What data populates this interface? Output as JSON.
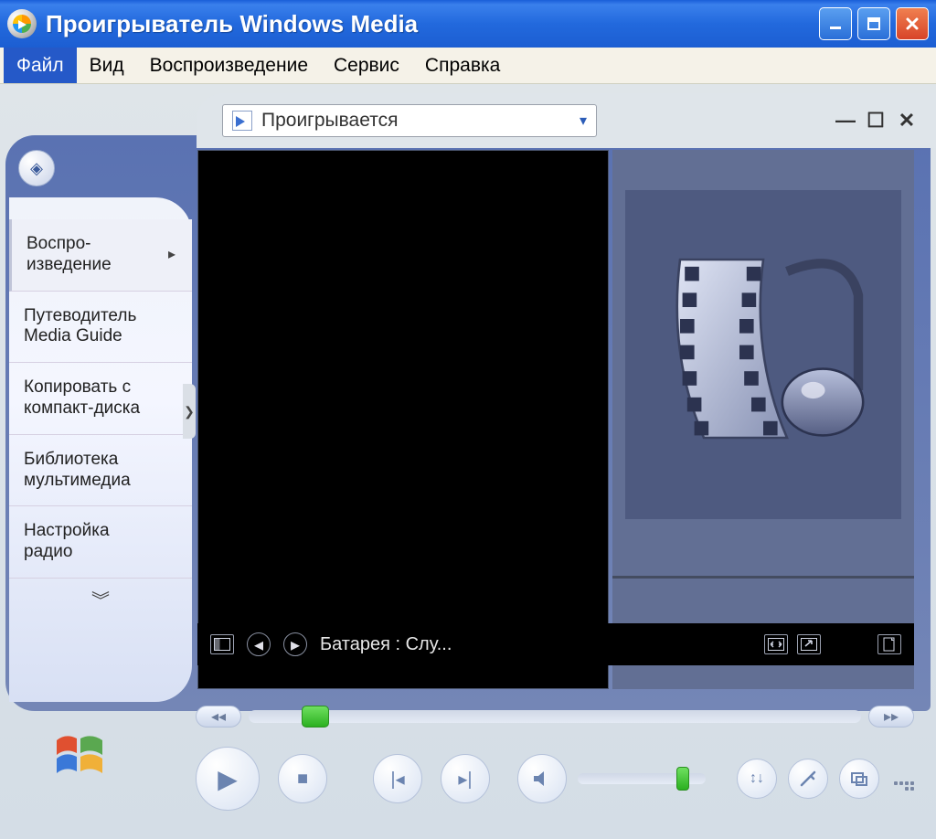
{
  "titlebar": {
    "title": "Проигрыватель Windows Media"
  },
  "menubar": {
    "items": [
      {
        "label": "Файл",
        "active": true
      },
      {
        "label": "Вид"
      },
      {
        "label": "Воспроизведение"
      },
      {
        "label": "Сервис"
      },
      {
        "label": "Справка"
      }
    ]
  },
  "nowplaying_dropdown": {
    "label": "Проигрывается"
  },
  "sidebar": {
    "tabs": [
      {
        "label": "Воспро-\nизведение",
        "active": true,
        "has_arrow": true
      },
      {
        "label": "Путеводитель\nMedia Guide"
      },
      {
        "label": "Копировать с\nкомпакт-диска"
      },
      {
        "label": "Библиотека\nмультимедиа"
      },
      {
        "label": "Настройка\nрадио"
      }
    ]
  },
  "infobar": {
    "track_text": "Батарея : Слу..."
  },
  "icons": {
    "minimize": "_",
    "maximize": "□",
    "close": "×",
    "chevron_down": "▾",
    "chevron_right": "▸",
    "more_down": "︾",
    "refresh": "↻",
    "prev_small": "◂",
    "next_small": "▸",
    "switch_view": "⧉",
    "fullscreen": "↗",
    "doc": "▣",
    "rewind": "◂◂",
    "forward": "▸▸",
    "play": "▶",
    "stop": "■",
    "skip_prev": "⏮",
    "skip_next": "⏭",
    "volume": "🔈",
    "shuffle": "↕",
    "eq": "✎"
  }
}
